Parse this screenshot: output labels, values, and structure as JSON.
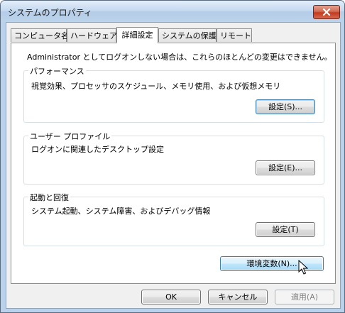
{
  "window": {
    "title": "システムのプロパティ"
  },
  "tabs": [
    {
      "label": "コンピュータ名"
    },
    {
      "label": "ハードウェア"
    },
    {
      "label": "詳細設定"
    },
    {
      "label": "システムの保護"
    },
    {
      "label": "リモート"
    }
  ],
  "active_tab": "詳細設定",
  "panel": {
    "admin_note": "Administrator としてログオンしない場合は、これらのほとんどの変更はできません。",
    "performance": {
      "label": "パフォーマンス",
      "desc": "視覚効果、プロセッサのスケジュール、メモリ使用、および仮想メモリ",
      "button": "設定(S)..."
    },
    "profile": {
      "label": "ユーザー プロファイル",
      "desc": "ログオンに関連したデスクトップ設定",
      "button": "設定(E)..."
    },
    "startup": {
      "label": "起動と回復",
      "desc": "システム起動、システム障害、およびデバッグ情報",
      "button": "設定(T)"
    },
    "env_button": "環境変数(N)..."
  },
  "footer": {
    "ok": "OK",
    "cancel": "キャンセル",
    "apply": "適用(A)"
  },
  "colors": {
    "close_button": "#c23a1f",
    "title_bar": "#bcd3ec",
    "hot_button": "#bee6fd"
  }
}
